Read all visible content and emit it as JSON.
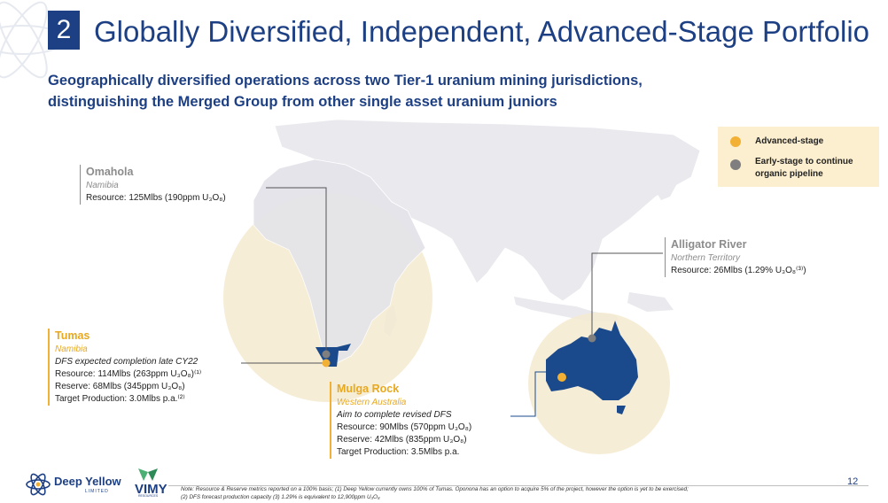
{
  "header": {
    "section_number": "2",
    "title": "Globally Diversified, Independent, Advanced-Stage Portfolio",
    "subtitle_line1": "Geographically diversified operations across two Tier-1 uranium mining jurisdictions,",
    "subtitle_line2": "distinguishing the Merged Group from other single asset uranium juniors"
  },
  "legend": {
    "items": [
      {
        "label": "Advanced-stage",
        "color": "#f2b134"
      },
      {
        "label_line1": "Early-stage to continue",
        "label_line2": "organic pipeline",
        "color": "#7f7f7f"
      }
    ]
  },
  "projects": {
    "omahola": {
      "name": "Omahola",
      "region": "Namibia",
      "resource": "Resource: 125Mlbs (190ppm U₃O₈)"
    },
    "alligator": {
      "name": "Alligator River",
      "region": "Northern Territory",
      "resource": "Resource: 26Mlbs (1.29% U₃O₈⁽³⁾)"
    },
    "tumas": {
      "name": "Tumas",
      "region": "Namibia",
      "dfs": "DFS expected completion late CY22",
      "resource": "Resource: 114Mlbs (263ppm U₃O₈)⁽¹⁾",
      "reserve": "Reserve: 68Mlbs (345ppm U₃O₈)",
      "production": "Target Production: 3.0Mlbs p.a.⁽²⁾"
    },
    "mulga": {
      "name": "Mulga Rock",
      "region": "Western Australia",
      "dfs": "Aim to complete revised DFS",
      "resource": "Resource: 90Mlbs (570ppm U₃O₈)",
      "reserve": "Reserve: 42Mlbs (835ppm U₃O₈)",
      "production": "Target Production: 3.5Mlbs p.a."
    }
  },
  "footer": {
    "note_line1": "Note: Resource & Reserve metrics reported on a 100% basis; (1) Deep Yellow currently owns 100% of Tumas. Oponona has an option to acquire 5% of the project, however the option is yet to be exercised;",
    "note_line2": "(2) DFS forecast production capacity (3) 1.29% is equivalent to 12,900ppm U₃O₈",
    "page_number": "12",
    "logo_deep_yellow": "Deep Yellow",
    "logo_deep_yellow_sub": "LIMITED",
    "logo_vimy": "VIMY",
    "logo_vimy_sub": "RESOURCES"
  },
  "colors": {
    "brand_blue": "#1d3f83",
    "gold": "#f2b134",
    "grey_dot": "#7f7f7f",
    "halo": "#f6ecd0",
    "land": "#e8e8ec",
    "highlight_country": "#1a4a8c"
  }
}
